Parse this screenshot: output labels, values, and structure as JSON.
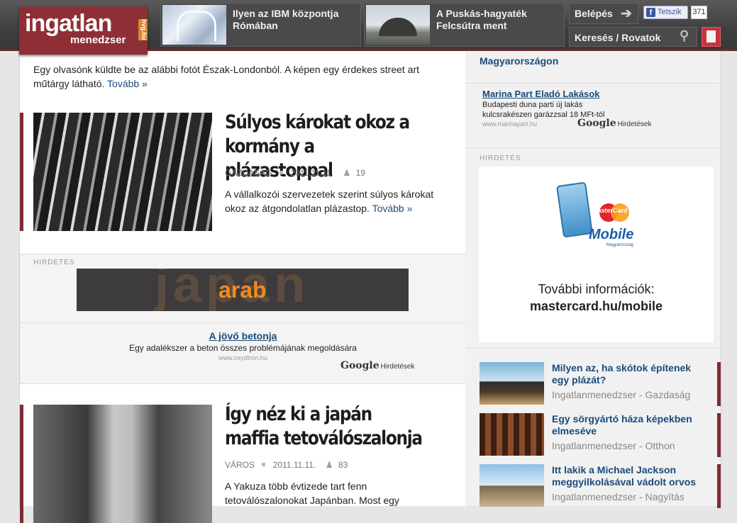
{
  "header": {
    "logo_main": "ingatlan",
    "logo_sub": "menedzser",
    "logo_tag": "hvg.hu",
    "promos": [
      {
        "title": "Ilyen az IBM központja Rómában"
      },
      {
        "title": "A Puskás-hagyaték Felcsútra ment"
      }
    ],
    "login_label": "Belépés",
    "search_label": "Keresés / Rovatok",
    "fb_like_label": "Tetszik",
    "fb_like_count": "371"
  },
  "main": {
    "intro_text": "Egy olvasónk küldte be az alábbi fotót Észak-Londonból. A képen egy érdekes street art műtárgy látható.",
    "intro_more": "Tovább »",
    "articles": [
      {
        "title": "Súlyos károkat okoz a kormány a plázastoppal",
        "category": "GAZDASÁG",
        "date": "2011.11.11.",
        "comments": "19",
        "lead": "A vállalkozói szervezetek szerint súlyos károkat okoz az átgondolatlan plázastop.",
        "more": "Tovább »"
      },
      {
        "title": "Így néz ki a japán maffia tetoválószalonja",
        "category": "VÁROS",
        "date": "2011.11.11.",
        "comments": "83",
        "lead": "A Yakuza több évtizede tart fenn tetoválószalonokat Japánban. Most egy",
        "more": ""
      }
    ],
    "ad_label": "HIRDETÉS",
    "banner_bg_text": "japan",
    "banner_fg_text": "arab",
    "google_ad": {
      "title": "A jövő betonja",
      "desc": "Egy adalékszer a beton összes problémájának megoldására",
      "url": "www.oxydtron.hu",
      "google": "Google",
      "label": "Hirdetések"
    }
  },
  "sidebar": {
    "cut_text": "Magyarországon",
    "google_ad": {
      "title": "Marina Part Eladó Lakások",
      "desc": "Budapesti duna parti új lakás kulcsrakészen garázzsal 18 MFt-tól",
      "url": "www.marinapart.hu",
      "google": "Google",
      "label": "Hirdetések"
    },
    "ad_label": "HIRDETÉS",
    "mastercard": {
      "brand": "MasterCard",
      "product": "Mobile",
      "product_sub": "Magyarország",
      "info": "További információk:",
      "site": "mastercard.hu/mobile"
    },
    "related": [
      {
        "title": "Milyen az, ha skótok építenek egy plázát?",
        "source": "Ingatlanmenedzser - Gazdaság"
      },
      {
        "title": "Egy sörgyártó háza képekben elmeséve",
        "source": "Ingatlanmenedzser - Otthon"
      },
      {
        "title": "Itt lakik a Michael Jackson meggyilkolásával vádolt orvos",
        "source": "Ingatlanmenedzser - Nagyítás"
      }
    ]
  }
}
